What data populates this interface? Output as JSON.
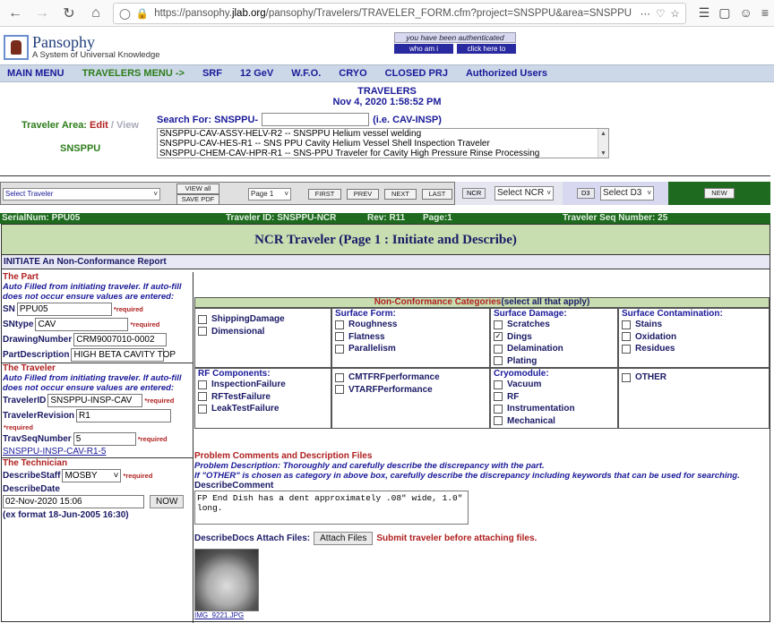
{
  "browser": {
    "url_prefix": "https://pansophy.",
    "url_host": "jlab.org",
    "url_rest": "/pansophy/Travelers/TRAVELER_FORM.cfm?project=SNSPPU&area=SNSPPU"
  },
  "logo": {
    "name": "Pansophy",
    "tagline": "A System of Universal Knowledge"
  },
  "auth": {
    "status": "you have been authenticated",
    "who": "who am i",
    "logout": "click here to logout"
  },
  "menu": [
    "MAIN MENU",
    "TRAVELERS MENU ->",
    "SRF",
    "12 GeV",
    "W.F.O.",
    "CRYO",
    "CLOSED PRJ",
    "Authorized Users"
  ],
  "page": {
    "title": "TRAVELERS",
    "datetime": "Nov 4, 2020 1:58:52 PM"
  },
  "area": {
    "label": "Traveler Area:",
    "edit": "Edit",
    "slash": "/",
    "view": "View",
    "name": "SNSPPU"
  },
  "search": {
    "label": "Search For: SNSPPU-",
    "hint": "(i.e. CAV-INSP)",
    "results": [
      "SNSPPU-CAV-ASSY-HELV-R2 -- SNSPPU Helium vessel welding",
      "SNSPPU-CAV-HES-R1 -- SNS PPU Cavity Helium Vessel Shell Inspection Traveler",
      "SNSPPU-CHEM-CAV-HPR-R1 -- SNS-PPU Traveler for Cavity High Pressure Rinse Processing"
    ]
  },
  "toolbar": {
    "select_traveler": "Select Traveler",
    "view_all": "VIEW all",
    "save_pdf": "SAVE PDF",
    "page_sel": "Page 1",
    "first": "FIRST",
    "prev": "PREV",
    "next": "NEXT",
    "last": "LAST",
    "ncr_lbl": "NCR",
    "ncr_sel": "Select NCR",
    "d3_lbl": "D3",
    "d3_sel": "Select D3",
    "new": "NEW"
  },
  "info": {
    "serial": "SerialNum: PPU05",
    "traveler_id": "Traveler ID: SNSPPU-NCR",
    "rev": "Rev: R11",
    "page": "Page:1",
    "seq": "Traveler Seq Number: 25"
  },
  "ncr": {
    "title": "NCR Traveler (Page 1 : Initiate and Describe)",
    "initiate": "INITIATE An Non-Conformance Report"
  },
  "part": {
    "heading": "The Part",
    "note": "Auto Filled from initiating traveler. If auto-fill does not occur ensure values are entered:",
    "sn_lbl": "SN",
    "sn": "PPU05",
    "sntype_lbl": "SNtype",
    "sntype": "CAV",
    "drawing_lbl": "DrawingNumber",
    "drawing": "CRM9007010-0002",
    "desc_lbl": "PartDescription",
    "desc": "HIGH BETA CAVITY TOP",
    "required": "*required"
  },
  "traveler": {
    "heading": "The Traveler",
    "note": "Auto Filled from initiating traveler. If auto-fill does not occur ensure values are entered:",
    "id_lbl": "TravelerID",
    "id": "SNSPPU-INSP-CAV",
    "rev_lbl": "TravelerRevision",
    "rev": "R1",
    "seq_lbl": "TravSeqNumber",
    "seq": "5",
    "link": "SNSPPU-INSP-CAV-R1-5",
    "required": "*required"
  },
  "technician": {
    "heading": "The Technician",
    "staff_lbl": "DescribeStaff",
    "staff": "MOSBY",
    "date_lbl": "DescribeDate",
    "date": "02-Nov-2020 15:06",
    "now": "NOW",
    "format": "(ex format 18-Jun-2005 16:30)",
    "required": "*required"
  },
  "categories": {
    "title": "Non-Conformance Categories",
    "sub": "(select all that apply)",
    "col1": [
      "ShippingDamage",
      "Dimensional"
    ],
    "surface_form": {
      "h": "Surface Form:",
      "items": [
        "Roughness",
        "Flatness",
        "Parallelism"
      ]
    },
    "surface_damage": {
      "h": "Surface Damage:",
      "items": [
        "Scratches",
        "Dings",
        "Delamination",
        "Plating"
      ],
      "checked": [
        false,
        true,
        false,
        false
      ]
    },
    "surface_contam": {
      "h": "Surface Contamination:",
      "items": [
        "Stains",
        "Oxidation",
        "Residues"
      ]
    },
    "rf": {
      "h": "RF Components:",
      "items": [
        "InspectionFailure",
        "RFTestFailure",
        "LeakTestFailure"
      ]
    },
    "perf": [
      "CMTFRFperformance",
      "VTARFPerformance"
    ],
    "cryo": {
      "h": "Cryomodule:",
      "items": [
        "Vacuum",
        "RF",
        "Instrumentation",
        "Mechanical"
      ]
    },
    "other": "OTHER"
  },
  "problem": {
    "heading": "Problem Comments and Description Files",
    "desc1": "Problem Description: Thoroughly and carefully describe the discrepancy with the part.",
    "desc2": "If \"OTHER\" is chosen as category in above box, carefully describe the discrepancy including keywords that can be used for searching.",
    "comment_lbl": "DescribeComment",
    "comment": "FP End Dish has a dent approximately .08\" wide, 1.0\" long.",
    "attach_lbl": "DescribeDocs Attach Files:",
    "attach_btn": "Attach Files",
    "attach_note": "Submit traveler before attaching files.",
    "thumb_caption": "IMG_9221.JPG"
  }
}
